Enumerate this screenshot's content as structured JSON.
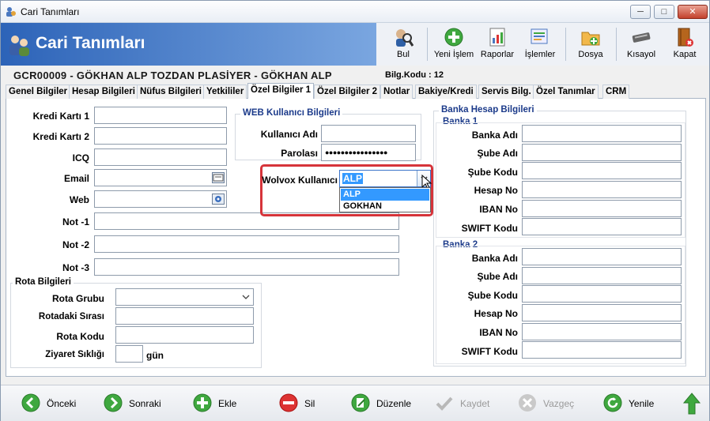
{
  "window": {
    "title": "Cari Tanımları",
    "min": "─",
    "max": "□",
    "close": "✕"
  },
  "header": {
    "title": "Cari Tanımları"
  },
  "toolbar": [
    {
      "label": "Bul",
      "icon": "search-user-icon"
    },
    {
      "label": "Yeni İşlem",
      "icon": "add-icon"
    },
    {
      "label": "Raporlar",
      "icon": "report-icon"
    },
    {
      "label": "İşlemler",
      "icon": "operations-icon"
    },
    {
      "label": "Dosya",
      "icon": "folder-icon"
    },
    {
      "label": "Kısayol",
      "icon": "keyboard-icon"
    },
    {
      "label": "Kapat",
      "icon": "close-book-icon"
    }
  ],
  "record": {
    "text": "GCR00009  -  GÖKHAN ALP TOZDAN PLASİYER  -  GÖKHAN   ALP",
    "bilg": "Bilg.Kodu : 12"
  },
  "tabs": [
    "Genel Bilgiler",
    "Hesap Bilgileri",
    "Nüfus Bilgileri",
    "Yetkililer",
    "Özel Bilgiler 1",
    "Özel Bilgiler 2",
    "Notlar",
    "Bakiye/Kredi",
    "Servis Bilg.",
    "Özel Tanımlar",
    "CRM"
  ],
  "form": {
    "kredi1": "Kredi Kartı 1",
    "kredi2": "Kredi Kartı 2",
    "icq": "ICQ",
    "email": "Email",
    "web": "Web",
    "not1": "Not -1",
    "not2": "Not -2",
    "not3": "Not -3"
  },
  "web_group": {
    "title": "WEB Kullanıcı Bilgileri",
    "user_label": "Kullanıcı Adı",
    "pass_label": "Parolası",
    "pass_value": "●●●●●●●●●●●●●●●●"
  },
  "wolvox": {
    "label": "Wolvox Kullanıcı",
    "value": "ALP",
    "options": [
      "ALP",
      "GOKHAN"
    ]
  },
  "rota": {
    "title": "Rota Bilgileri",
    "grup": "Rota Grubu",
    "sira": "Rotadaki Sırası",
    "kod": "Rota Kodu",
    "siklik": "Ziyaret Sıklığı",
    "gun": "gün"
  },
  "banka": {
    "title": "Banka Hesap Bilgileri",
    "b1": "Banka 1",
    "b2": "Banka 2",
    "fields": [
      "Banka Adı",
      "Şube Adı",
      "Şube Kodu",
      "Hesap No",
      "IBAN No",
      "SWIFT Kodu"
    ]
  },
  "bottom": [
    {
      "label": "Önceki",
      "icon": "arrow-left-icon",
      "enabled": true
    },
    {
      "label": "Sonraki",
      "icon": "arrow-right-icon",
      "enabled": true
    },
    {
      "label": "Ekle",
      "icon": "plus-icon",
      "enabled": true
    },
    {
      "label": "Sil",
      "icon": "minus-icon",
      "enabled": true
    },
    {
      "label": "Düzenle",
      "icon": "edit-icon",
      "enabled": true
    },
    {
      "label": "Kaydet",
      "icon": "check-icon",
      "enabled": false
    },
    {
      "label": "Vazgeç",
      "icon": "cancel-icon",
      "enabled": false
    },
    {
      "label": "Yenile",
      "icon": "refresh-icon",
      "enabled": true
    }
  ],
  "colors": {
    "accent": "#2c63b8",
    "highlight": "#3399ff",
    "alert": "#d6343a",
    "green": "#3fa83f",
    "red": "#d33"
  }
}
